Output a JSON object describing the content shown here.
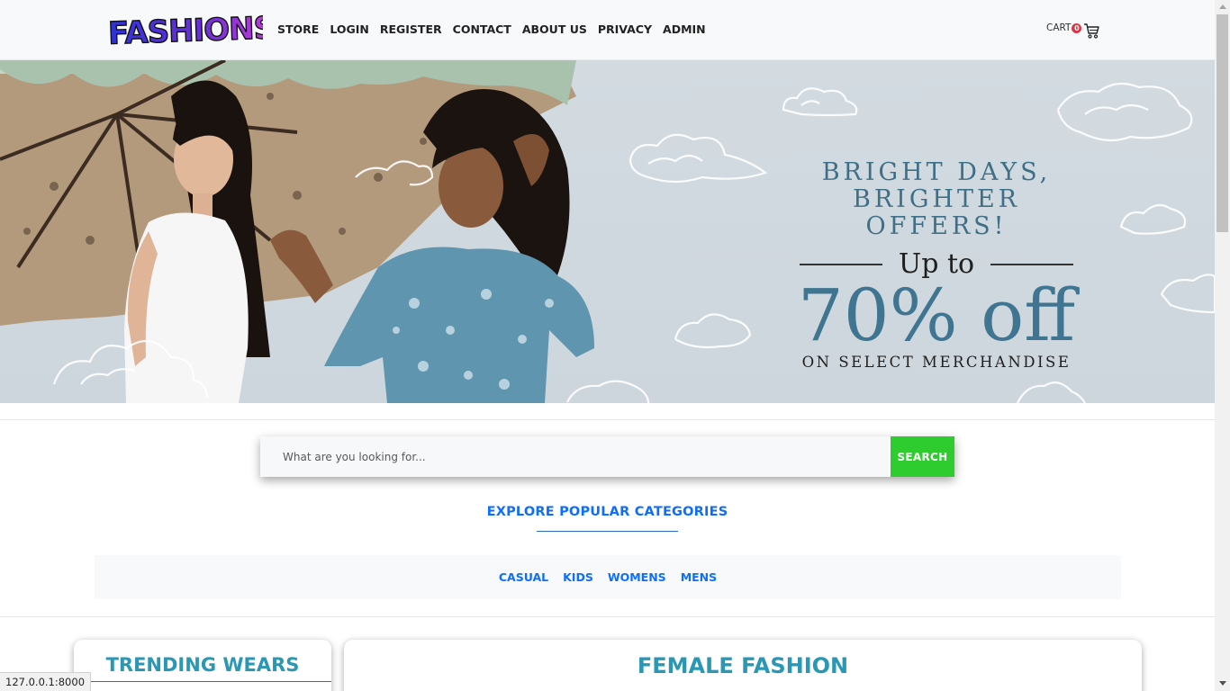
{
  "brand": {
    "logo_text": "FASHIONS"
  },
  "nav": {
    "links": [
      "STORE",
      "LOGIN",
      "REGISTER",
      "CONTACT",
      "ABOUT US",
      "PRIVACY",
      "ADMIN"
    ],
    "cart_label": "CART",
    "cart_count": "0"
  },
  "hero": {
    "line1": "BRIGHT DAYS,",
    "line2": "BRIGHTER OFFERS!",
    "upto": "Up to",
    "discount": "70% off",
    "subline": "ON SELECT MERCHANDISE"
  },
  "search": {
    "placeholder": "What are you looking for...",
    "button": "SEARCH"
  },
  "categories": {
    "heading": "EXPLORE POPULAR CATEGORIES",
    "items": [
      "CASUAL",
      "KIDS",
      "WOMENS",
      "MENS"
    ]
  },
  "sections": {
    "trending_title": "TRENDING WEARS",
    "female_title": "FEMALE FASHION"
  },
  "status_bar": {
    "url": "127.0.0.1:8000"
  },
  "colors": {
    "accent_blue": "#0d6efd",
    "search_green": "#2ecc2e",
    "teal_title": "#2a97b4",
    "promo_teal": "#3f6f86",
    "cart_badge": "#dc3545"
  }
}
